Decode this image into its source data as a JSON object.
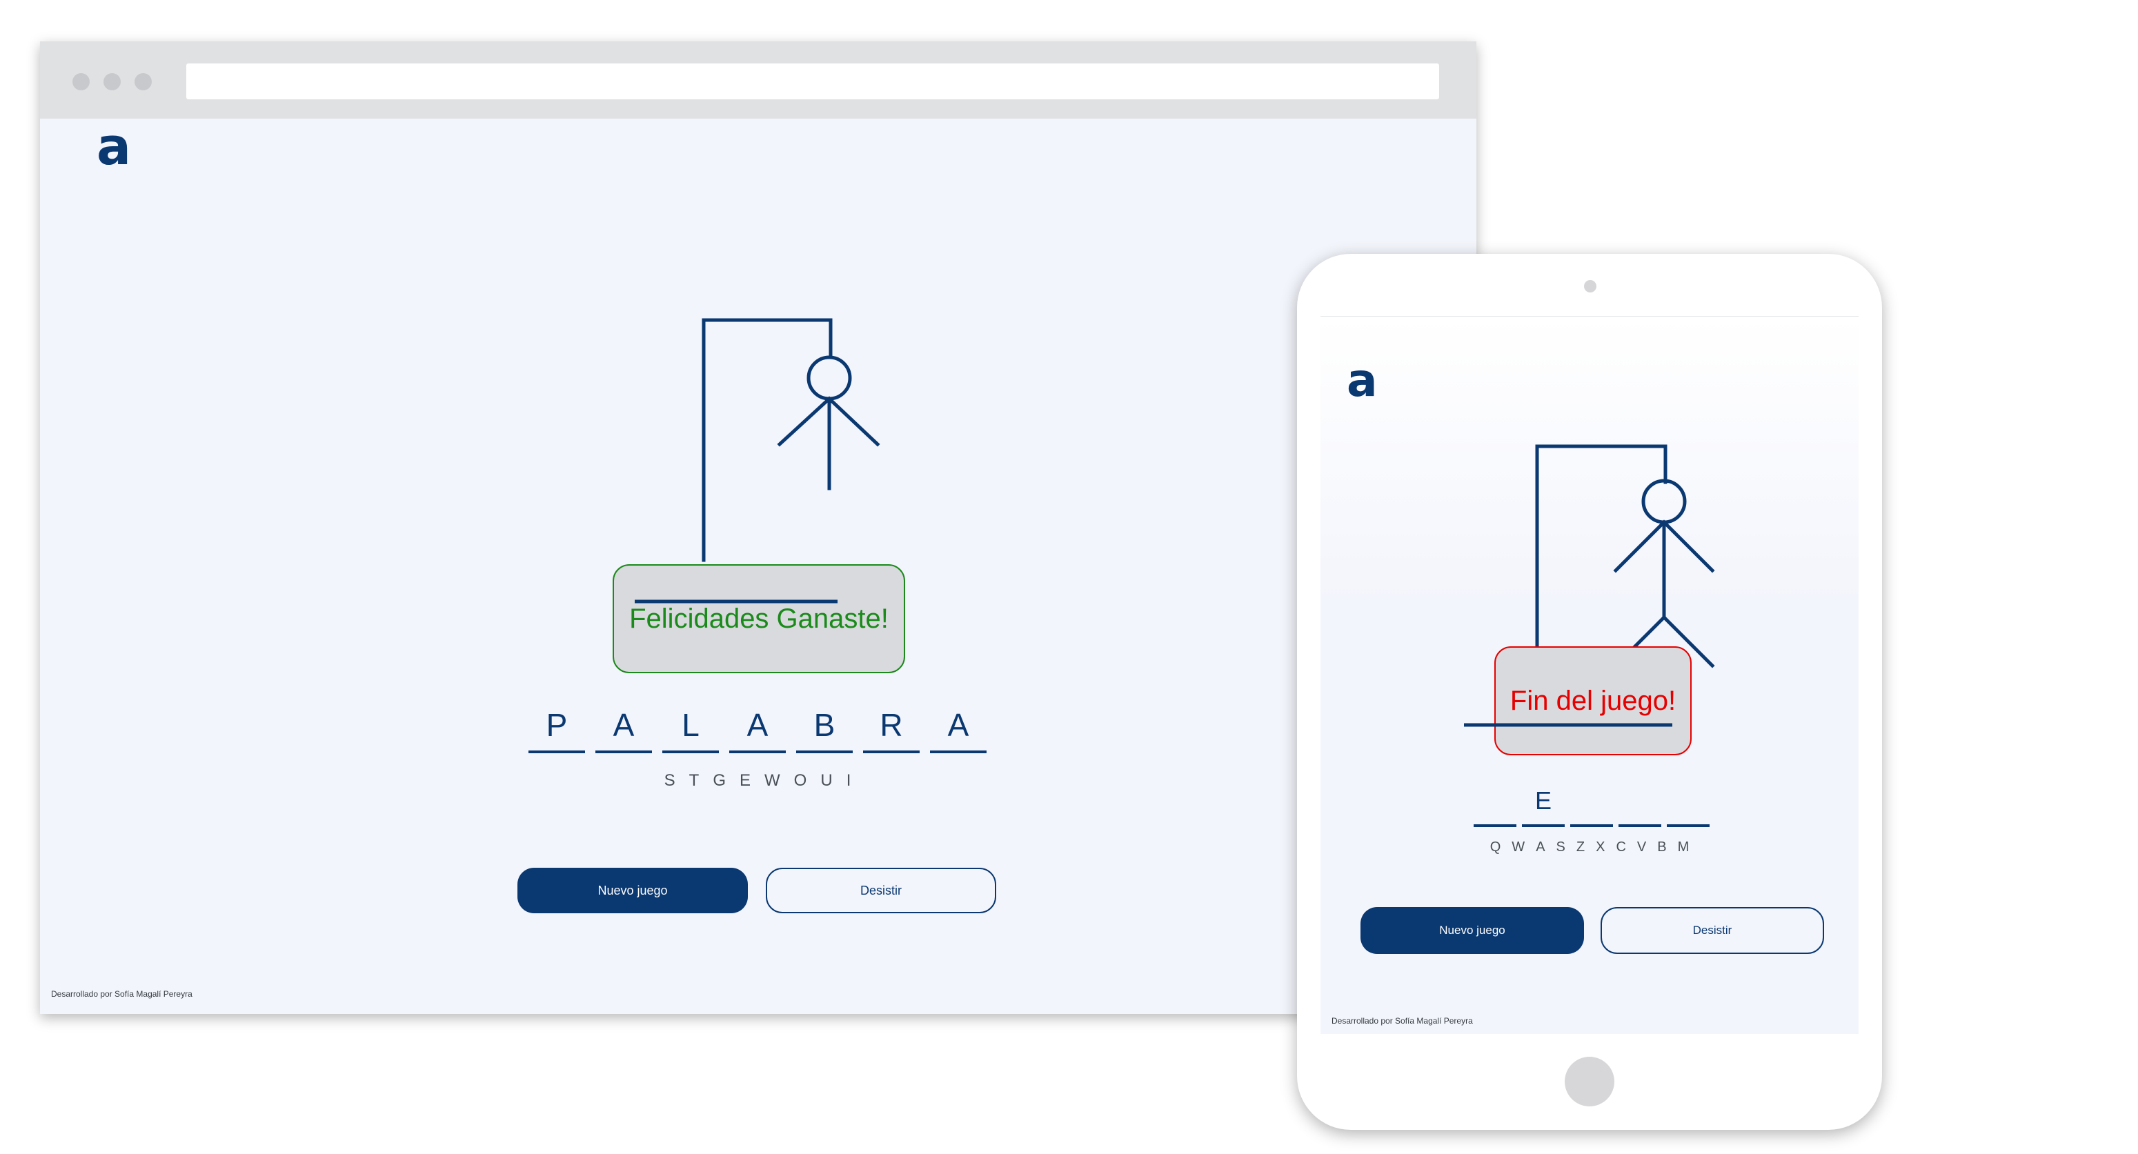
{
  "desktop": {
    "logo": "a",
    "message": "Felicidades Ganaste!",
    "message_color": "#1a8a1a",
    "word_letters": [
      "P",
      "A",
      "L",
      "A",
      "B",
      "R",
      "A"
    ],
    "wrong_letters": [
      "S",
      "T",
      "G",
      "E",
      "W",
      "O",
      "U",
      "I"
    ],
    "buttons": {
      "new_game": "Nuevo juego",
      "give_up": "Desistir"
    },
    "footer": "Desarrollado por Sofía Magalí Pereyra"
  },
  "tablet": {
    "logo": "a",
    "message": "Fin del juego!",
    "message_color": "#e60000",
    "word_letters": [
      "",
      "E",
      "",
      "",
      ""
    ],
    "wrong_letters": [
      "Q",
      "W",
      "A",
      "S",
      "Z",
      "X",
      "C",
      "V",
      "B",
      "M"
    ],
    "buttons": {
      "new_game": "Nuevo juego",
      "give_up": "Desistir"
    },
    "footer": "Desarrollado por Sofía Magalí Pereyra"
  },
  "colors": {
    "brand": "#0a3871",
    "background": "#f3f5fc",
    "message_box": "#d9dadd"
  }
}
